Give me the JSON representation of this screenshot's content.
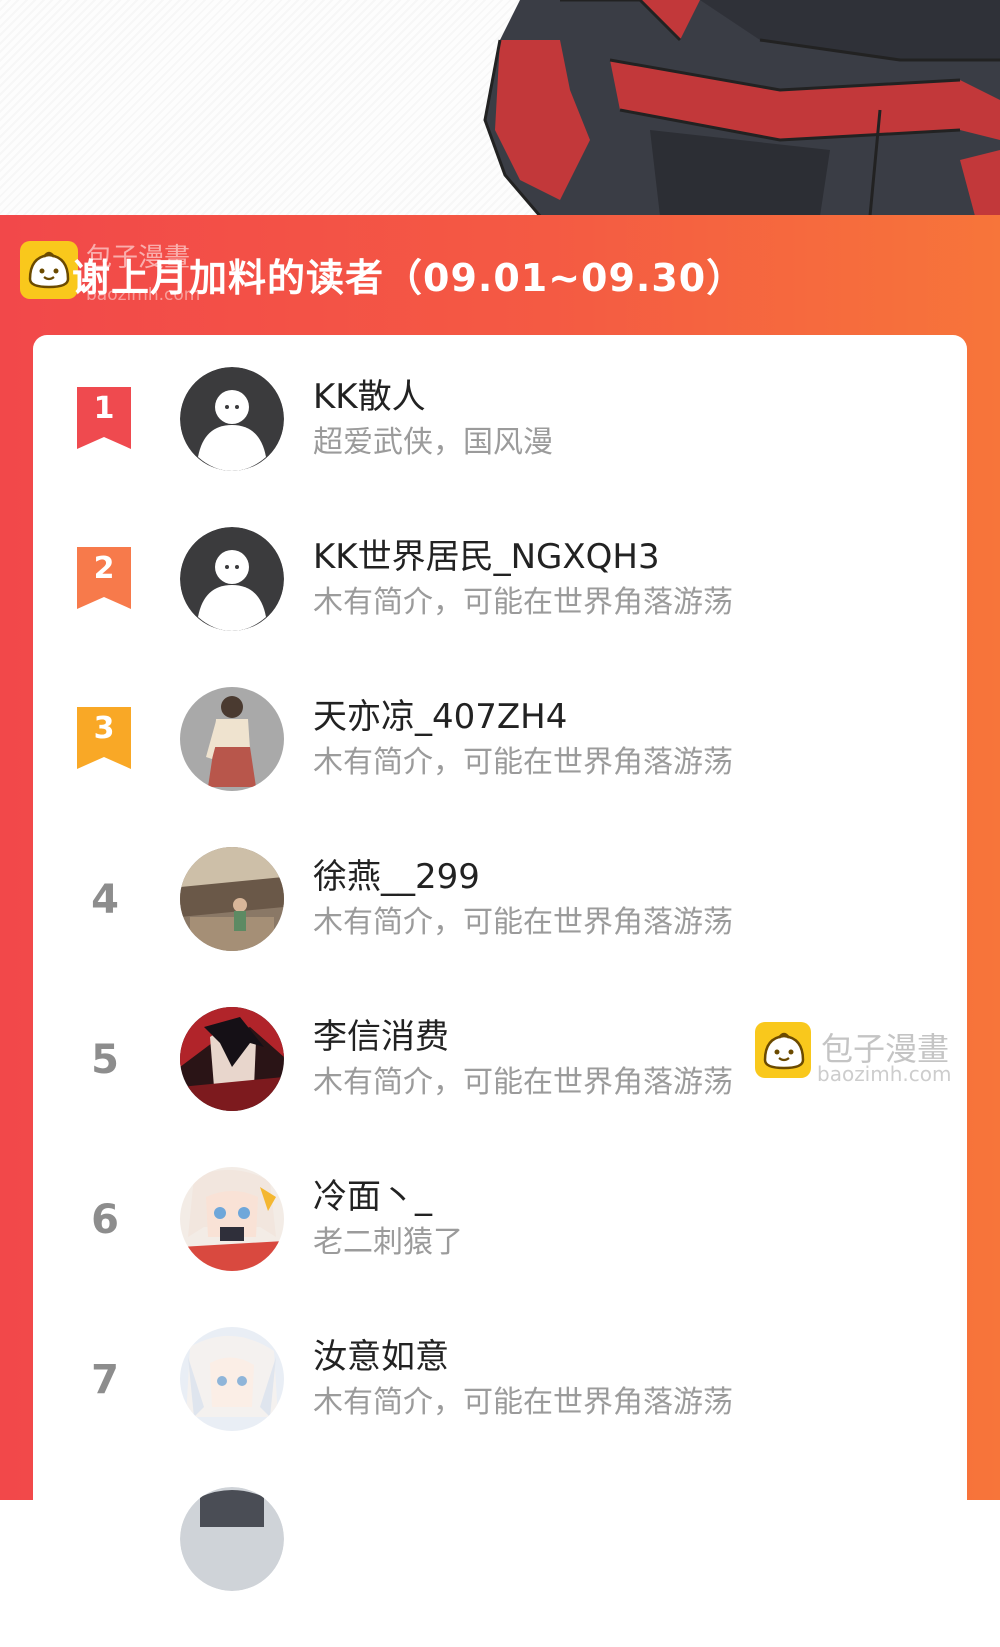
{
  "header": {
    "title": "谢上月加料的读者（09.01~09.30）",
    "watermark_text": "包子漫畫",
    "watermark_url": "baozimh.com"
  },
  "readers": [
    {
      "rank": "1",
      "name": "KK散人",
      "bio": "超爱武侠，国风漫",
      "avatar": "default-avatar-icon"
    },
    {
      "rank": "2",
      "name": "KK世界居民_NGXQH3",
      "bio": "木有简介，可能在世界角落游荡",
      "avatar": "default-avatar-icon"
    },
    {
      "rank": "3",
      "name": "天亦凉_407ZH4",
      "bio": "木有简介，可能在世界角落游荡",
      "avatar": "user-avatar"
    },
    {
      "rank": "4",
      "name": "徐燕__299",
      "bio": "木有简介，可能在世界角落游荡",
      "avatar": "user-avatar"
    },
    {
      "rank": "5",
      "name": "李信消费",
      "bio": "木有简介，可能在世界角落游荡",
      "avatar": "user-avatar"
    },
    {
      "rank": "6",
      "name": "冷面丶_",
      "bio": "老二刺猿了",
      "avatar": "user-avatar"
    },
    {
      "rank": "7",
      "name": "汝意如意",
      "bio": "木有简介，可能在世界角落游荡",
      "avatar": "user-avatar"
    }
  ],
  "watermark": {
    "text": "包子漫畫",
    "url": "baozimh.com"
  },
  "colors": {
    "panel_red": "#f2484a",
    "panel_orange": "#f7753a",
    "rank1": "#ef4a4f",
    "rank2": "#f77a4b",
    "rank3": "#f9a826",
    "logo_yellow": "#f9c81c"
  }
}
